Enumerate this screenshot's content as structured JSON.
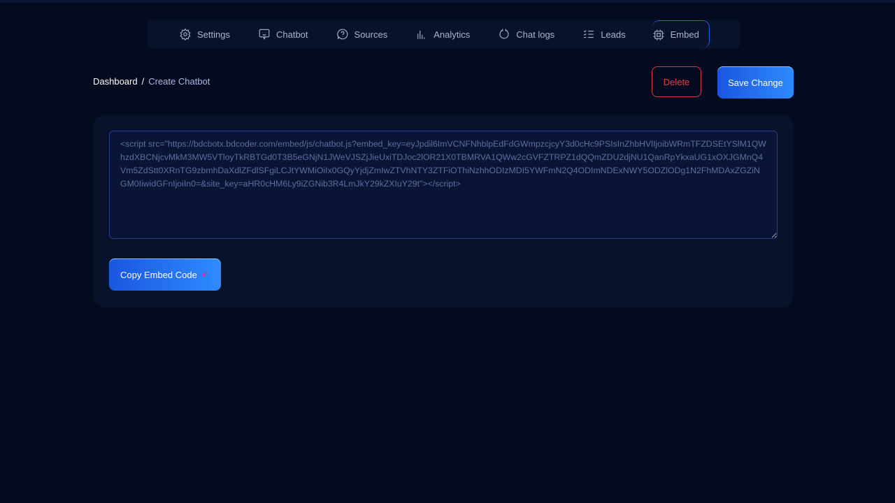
{
  "nav": {
    "items": [
      {
        "label": "Settings",
        "icon": "gear-icon"
      },
      {
        "label": "Chatbot",
        "icon": "chat-bubble-icon"
      },
      {
        "label": "Sources",
        "icon": "question-bubble-icon"
      },
      {
        "label": "Analytics",
        "icon": "bar-chart-icon"
      },
      {
        "label": "Chat logs",
        "icon": "refresh-icon"
      },
      {
        "label": "Leads",
        "icon": "checklist-icon"
      },
      {
        "label": "Embed",
        "icon": "chip-icon"
      }
    ],
    "active": "Embed"
  },
  "breadcrumb": {
    "root": "Dashboard",
    "separator": "/",
    "current": "Create Chatbot"
  },
  "actions": {
    "delete": "Delete",
    "save": "Save Change"
  },
  "embed": {
    "code": "<script src=\"https://bdcbotx.bdcoder.com/embed/js/chatbot.js?embed_key=eyJpdil6ImVCNFNhblpEdFdGWmpzcjcyY3d0cHc9PSIsInZhbHVlIjoibWRmTFZDSEtYSlM1QWhzdXBCNjcvMkM3MW5VTloyTkRBTGd0T3B5eGNjN1JWeVJSZjJieUxiTDJoc2lOR21X0TBMRVA1QWw2cGVFZTRPZ1dQQmZDU2djNU1QanRpYkxaUG1xOXJGMnQ4Vm5ZdStt0XRnTG9zbmhDaXdlZFdlSFgiLCJtYWMiOiIx0GQyYjdjZmIwZTVhNTY3ZTFiOThiNzhhODIzMDI5YWFmN2Q4ODImNDExNWY5ODZlODg1N2FhMDAxZGZiNGM0IiwidGFnIjoiIn0=&site_key=aHR0cHM6Ly9iZGNib3R4LmJkY29kZXIuY29t\"></script>",
    "copy_label": "Copy Embed Code",
    "copy_icon": "check-icon"
  },
  "colors": {
    "accent": "#1f5ed8",
    "danger": "#e0434c",
    "background": "#040b1e"
  }
}
